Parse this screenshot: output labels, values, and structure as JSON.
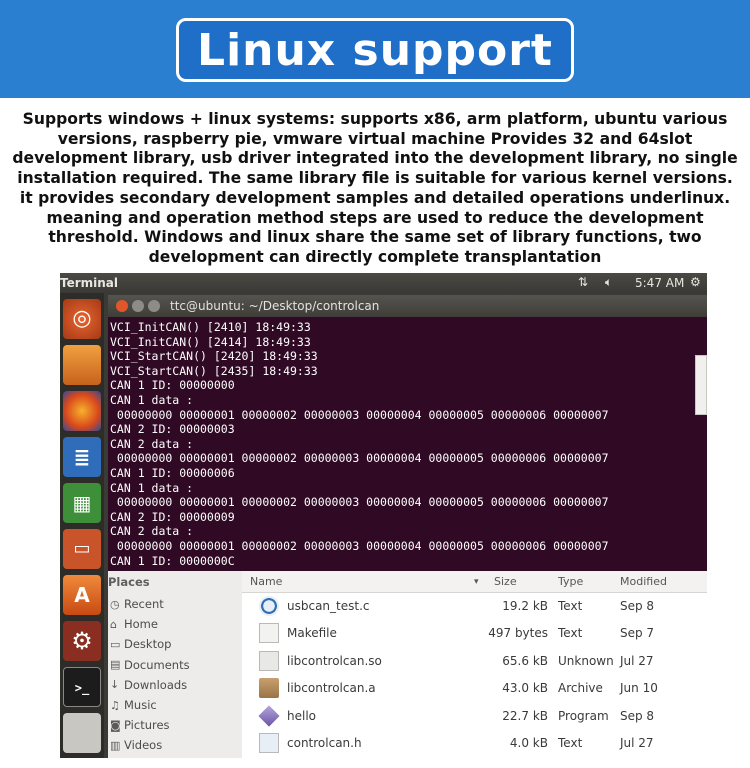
{
  "banner": {
    "title": "Linux support"
  },
  "description": "Supports windows + linux systems: supports x86, arm platform, ubuntu various versions, raspberry pie, vmware virtual machine Provides 32 and 64slot development library, usb driver integrated into the development library, no single installation required. The same library file is suitable for various kernel versions. it provides secondary development samples and detailed operations underlinux. meaning and operation method steps are used to reduce the development threshold. Windows and linux share the same set of library functions, two development can directly complete transplantation",
  "topbar": {
    "app_title": "Terminal",
    "time": "5:47 AM"
  },
  "terminal": {
    "title": "ttc@ubuntu: ~/Desktop/controlcan",
    "lines": [
      "VCI_InitCAN() [2410] 18:49:33",
      "VCI_InitCAN() [2414] 18:49:33",
      "VCI_StartCAN() [2420] 18:49:33",
      "VCI_StartCAN() [2435] 18:49:33",
      "CAN 1 ID: 00000000",
      "CAN 1 data :",
      " 00000000 00000001 00000002 00000003 00000004 00000005 00000006 00000007",
      "CAN 2 ID: 00000003",
      "CAN 2 data :",
      " 00000000 00000001 00000002 00000003 00000004 00000005 00000006 00000007",
      "CAN 1 ID: 00000006",
      "CAN 1 data :",
      " 00000000 00000001 00000002 00000003 00000004 00000005 00000006 00000007",
      "CAN 2 ID: 00000009",
      "CAN 2 data :",
      " 00000000 00000001 00000002 00000003 00000004 00000005 00000006 00000007",
      "CAN 1 ID: 0000000C"
    ]
  },
  "places": {
    "header": "Places",
    "items": [
      {
        "label": "Recent",
        "icon": "clock-icon"
      },
      {
        "label": "Home",
        "icon": "home-icon"
      },
      {
        "label": "Desktop",
        "icon": "desktop-icon"
      },
      {
        "label": "Documents",
        "icon": "documents-icon"
      },
      {
        "label": "Downloads",
        "icon": "download-icon"
      },
      {
        "label": "Music",
        "icon": "music-icon"
      },
      {
        "label": "Pictures",
        "icon": "camera-icon"
      },
      {
        "label": "Videos",
        "icon": "film-icon"
      }
    ]
  },
  "files": {
    "columns": {
      "name": "Name",
      "size": "Size",
      "type": "Type",
      "modified": "Modified"
    },
    "rows": [
      {
        "name": "usbcan_test.c",
        "size": "19.2 kB",
        "type": "Text",
        "modified": "Sep 8",
        "icon": "c-source-icon"
      },
      {
        "name": "Makefile",
        "size": "497 bytes",
        "type": "Text",
        "modified": "Sep 7",
        "icon": "text-file-icon"
      },
      {
        "name": "libcontrolcan.so",
        "size": "65.6 kB",
        "type": "Unknown",
        "modified": "Jul 27",
        "icon": "binary-file-icon"
      },
      {
        "name": "libcontrolcan.a",
        "size": "43.0 kB",
        "type": "Archive",
        "modified": "Jun 10",
        "icon": "archive-icon"
      },
      {
        "name": "hello",
        "size": "22.7 kB",
        "type": "Program",
        "modified": "Sep 8",
        "icon": "program-icon"
      },
      {
        "name": "controlcan.h",
        "size": "4.0 kB",
        "type": "Text",
        "modified": "Jul 27",
        "icon": "c-header-icon"
      }
    ]
  },
  "colors": {
    "banner": "#2a7fd0",
    "terminal_bg": "#300a24",
    "ubuntu_orange": "#e95420"
  }
}
